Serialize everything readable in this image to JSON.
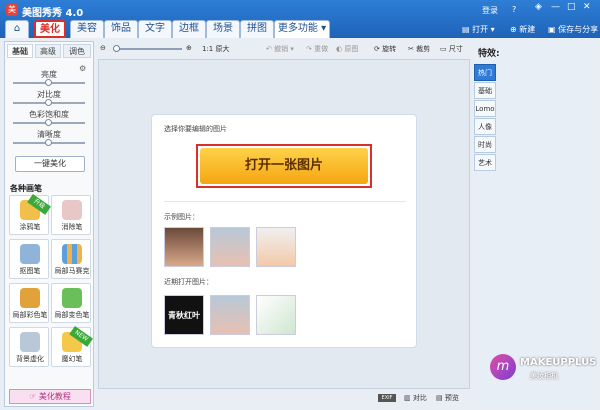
{
  "window": {
    "title": "美图秀秀 4.0",
    "login": "登录",
    "help": "?"
  },
  "nav": {
    "tabs": [
      "美化",
      "美容",
      "饰品",
      "文字",
      "边框",
      "场景",
      "拼图",
      "更多功能 ▾"
    ]
  },
  "header_actions": {
    "open": "打开 ▾",
    "new": "新建",
    "save": "保存与分享"
  },
  "left_panel": {
    "subtabs": [
      "基础",
      "高级",
      "调色"
    ],
    "sliders": [
      {
        "label": "亮度",
        "value": 0.5
      },
      {
        "label": "对比度",
        "value": 0.5
      },
      {
        "label": "色彩饱和度",
        "value": 0.5
      },
      {
        "label": "清晰度",
        "value": 0.5
      }
    ],
    "one_click": "一键美化",
    "brushes_title": "各种画笔",
    "tools": [
      "涂鸦笔",
      "消除笔",
      "抠图笔",
      "局部马赛克",
      "局部彩色笔",
      "局部变色笔",
      "背景虚化",
      "魔幻笔"
    ],
    "tool_badges": {
      "graffiti": "升级",
      "magic": "NEW"
    },
    "tutorial": "美化教程"
  },
  "toolbar": {
    "ratio": "1:1 原大",
    "undo": "撤销 ▾",
    "redo": "重做",
    "original": "原图",
    "rotate": "旋转",
    "crop": "裁剪",
    "size": "尺寸"
  },
  "canvas": {
    "prompt": "选择你要编辑的图片",
    "open_button": "打开一张图片",
    "samples_title": "示例图片：",
    "recent_title": "近期打开图片：",
    "recent_text": "青秋红叶"
  },
  "right_panel": {
    "title": "特效:",
    "tabs": [
      "热门",
      "基础",
      "Lomo",
      "人像",
      "时尚",
      "艺术"
    ],
    "brand": "MAKEUPPLUS",
    "brand_sub": "美妆相机"
  },
  "status": {
    "exif": "EXIF",
    "compare": "对比",
    "preview": "预览"
  },
  "colors": {
    "accent": "#2e7ed6",
    "highlight": "#d9302a",
    "button": "#f5a512"
  }
}
